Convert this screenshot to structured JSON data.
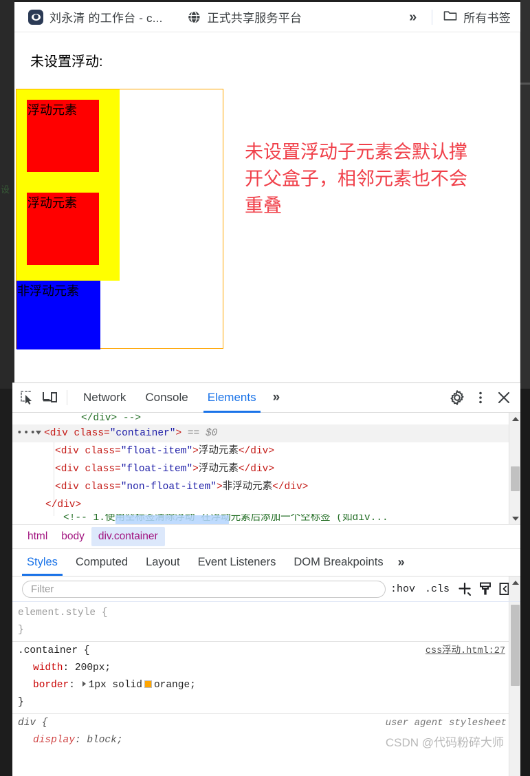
{
  "bookmarks": {
    "items": [
      {
        "icon": "eye-favicon",
        "label": "刘永清 的工作台 - c..."
      },
      {
        "icon": "globe-favicon",
        "label": "正式共享服务平台"
      }
    ],
    "overflow_label": "»",
    "all_bookmarks_label": "所有书签"
  },
  "page": {
    "heading": "未设置浮动:",
    "float_item_1": "浮动元素",
    "float_item_2": "浮动元素",
    "non_float_item": "非浮动元素",
    "annotation": "未设置浮动子元素会默认撑开父盒子，相邻元素也不会重叠",
    "annotation_color": "#f0404a",
    "container_border_color": "#ffa500",
    "yellow_color": "#ffff00",
    "red_color": "#ff0000",
    "blue_color": "#0000ff",
    "ghost_left_text": "设"
  },
  "devtools": {
    "toolbar": {
      "inspect_icon": "inspect-element-icon",
      "device_icon": "device-toolbar-icon",
      "settings_icon": "gear-icon",
      "more_icon": "kebab-menu-icon",
      "close_icon": "close-icon"
    },
    "tabs": [
      {
        "label": "Network",
        "active": false
      },
      {
        "label": "Console",
        "active": false
      },
      {
        "label": "Elements",
        "active": true
      }
    ],
    "tabs_overflow": "»",
    "dom": {
      "partial_top": "</div> -->",
      "selected_line": {
        "dots": "•••",
        "open": "<div class=",
        "quote": "\"",
        "class_value": "container",
        "close": ">",
        "marker": "== $0"
      },
      "children": [
        {
          "open": "<div class=",
          "class_value": "float-item",
          "text": "浮动元素",
          "close_tag": "</div>"
        },
        {
          "open": "<div class=",
          "class_value": "float-item",
          "text": "浮动元素",
          "close_tag": "</div>"
        },
        {
          "open": "<div class=",
          "class_value": "non-float-item",
          "text": "非浮动元素",
          "close_tag": "</div>"
        }
      ],
      "closing": "</div>",
      "partial_bottom": "<!-- 1.使用空标签清除浮动    在浮动元素后添加一个空标签 (如div..."
    },
    "breadcrumb": [
      {
        "label": "html",
        "active": false
      },
      {
        "label": "body",
        "active": false
      },
      {
        "label": "div.container",
        "active": true
      }
    ],
    "styles_tabs": [
      {
        "label": "Styles",
        "active": true
      },
      {
        "label": "Computed",
        "active": false
      },
      {
        "label": "Layout",
        "active": false
      },
      {
        "label": "Event Listeners",
        "active": false
      },
      {
        "label": "DOM Breakpoints",
        "active": false
      }
    ],
    "styles_tabs_overflow": "»",
    "filter": {
      "placeholder": "Filter",
      "value": "",
      "hov_label": ":hov",
      "cls_label": ".cls",
      "new_rule_icon": "plus-icon",
      "computed_icon": "paintbrush-icon",
      "sidebar_icon": "toggle-sidebar-icon"
    },
    "rules": [
      {
        "selector": "element.style {",
        "closing": "}",
        "source": "",
        "faded": true,
        "declarations": []
      },
      {
        "selector": ".container {",
        "closing": "}",
        "source": "css浮动.html:27",
        "faded": false,
        "declarations": [
          {
            "property": "width",
            "value": "200px;",
            "swatch": false,
            "expandable": false
          },
          {
            "property": "border",
            "value": "1px solid",
            "value_tail": "orange;",
            "swatch": true,
            "swatch_color": "#ffa500",
            "expandable": true
          }
        ]
      },
      {
        "selector": "div {",
        "closing": "",
        "source": "user agent stylesheet",
        "faded": false,
        "user_agent": true,
        "declarations": [
          {
            "property": "display",
            "value": "block;",
            "swatch": false,
            "expandable": false
          }
        ]
      }
    ],
    "watermark": "CSDN @代码粉碎大师"
  }
}
